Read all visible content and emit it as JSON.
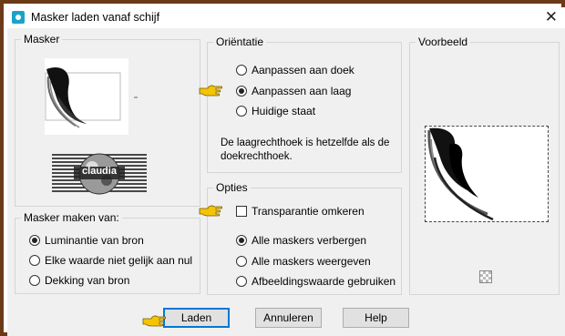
{
  "window": {
    "title": "Masker laden vanaf schijf",
    "close_glyph": "✕"
  },
  "masker_group": {
    "label": "Masker",
    "logo_text": "claudia"
  },
  "source_group": {
    "label": "Masker maken van:",
    "options": [
      {
        "label": "Luminantie van bron",
        "checked": true
      },
      {
        "label": "Elke waarde niet gelijk aan nul",
        "checked": false
      },
      {
        "label": "Dekking van bron",
        "checked": false
      }
    ]
  },
  "orientation_group": {
    "label": "Oriëntatie",
    "options": [
      {
        "label": "Aanpassen aan doek",
        "checked": false
      },
      {
        "label": "Aanpassen aan laag",
        "checked": true
      },
      {
        "label": "Huidige staat",
        "checked": false
      }
    ],
    "note": "De laagrechthoek is hetzelfde als de doekrechthoek."
  },
  "options_group": {
    "label": "Opties",
    "invert_label": "Transparantie omkeren",
    "invert_checked": false,
    "options": [
      {
        "label": "Alle maskers verbergen",
        "checked": true
      },
      {
        "label": "Alle maskers weergeven",
        "checked": false
      },
      {
        "label": "Afbeeldingswaarde gebruiken",
        "checked": false
      }
    ]
  },
  "preview_group": {
    "label": "Voorbeeld"
  },
  "buttons": {
    "load": "Laden",
    "cancel": "Annuleren",
    "help": "Help"
  },
  "colors": {
    "frame": "#6b3a18",
    "hand": "#f5c400",
    "default_border": "#0078d7"
  }
}
